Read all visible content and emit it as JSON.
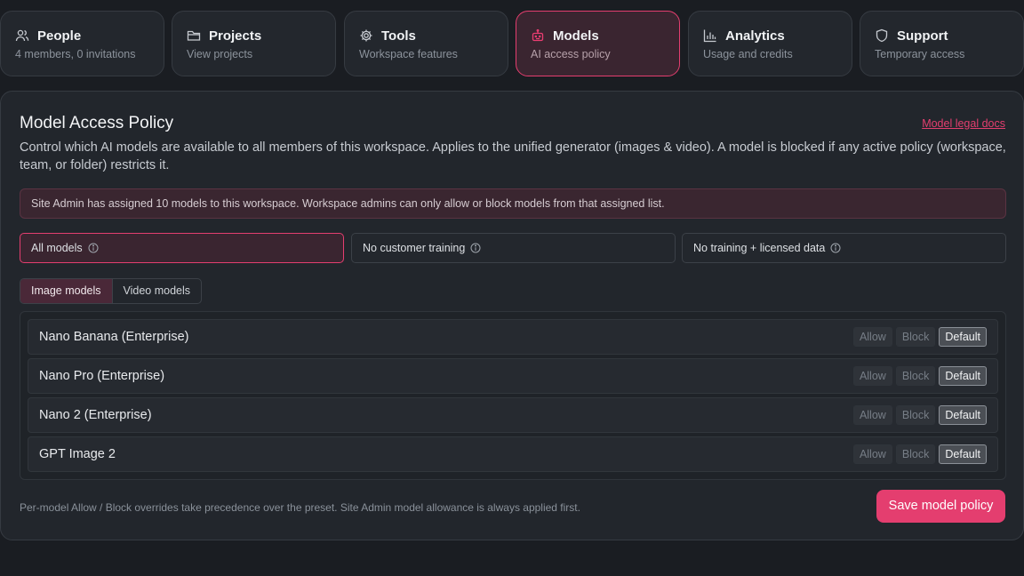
{
  "nav": [
    {
      "title": "People",
      "subtitle": "4 members, 0 invitations",
      "icon": "people-icon"
    },
    {
      "title": "Projects",
      "subtitle": "View projects",
      "icon": "folder-icon"
    },
    {
      "title": "Tools",
      "subtitle": "Workspace features",
      "icon": "gear-icon"
    },
    {
      "title": "Models",
      "subtitle": "AI access policy",
      "icon": "robot-icon",
      "active": true
    },
    {
      "title": "Analytics",
      "subtitle": "Usage and credits",
      "icon": "bar-chart-icon"
    },
    {
      "title": "Support",
      "subtitle": "Temporary access",
      "icon": "shield-icon"
    }
  ],
  "panel": {
    "title": "Model Access Policy",
    "legal_link": "Model legal docs",
    "description": "Control which AI models are available to all members of this workspace. Applies to the unified generator (images & video). A model is blocked if any active policy (workspace, team, or folder) restricts it.",
    "notice": "Site Admin has assigned 10 models to this workspace. Workspace admins can only allow or block models from that assigned list."
  },
  "presets": [
    {
      "label": "All models",
      "active": true
    },
    {
      "label": "No customer training"
    },
    {
      "label": "No training + licensed data"
    }
  ],
  "tabs": [
    {
      "label": "Image models",
      "active": true
    },
    {
      "label": "Video models"
    }
  ],
  "action_labels": {
    "allow": "Allow",
    "block": "Block",
    "default": "Default"
  },
  "models": [
    {
      "name": "Nano Banana (Enterprise)",
      "selected": "default"
    },
    {
      "name": "Nano Pro (Enterprise)",
      "selected": "default"
    },
    {
      "name": "Nano 2 (Enterprise)",
      "selected": "default"
    },
    {
      "name": "GPT Image 2",
      "selected": "default"
    }
  ],
  "footer": {
    "note": "Per-model Allow / Block overrides take precedence over the preset. Site Admin model allowance is always applied first.",
    "save_label": "Save model policy"
  },
  "colors": {
    "accent": "#e43e6f",
    "background": "#1a1d22",
    "panel": "#22262c"
  }
}
